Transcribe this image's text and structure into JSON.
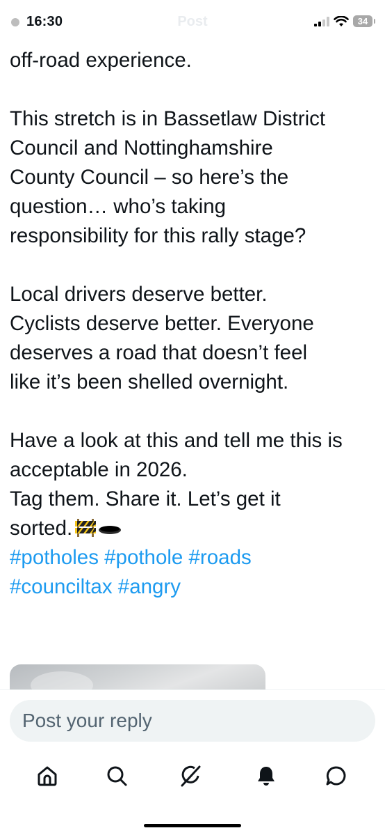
{
  "status_bar": {
    "time": "16:30",
    "header_title": "Post",
    "battery": "34"
  },
  "tweet": {
    "lines_first": [
      "off-road experience."
    ],
    "para2": [
      "This stretch is in Bassetlaw District",
      "Council and Nottinghamshire",
      "County Council – so here’s the",
      "question… who’s taking",
      "responsibility for this rally stage?"
    ],
    "para3": [
      "Local drivers deserve better.",
      "Cyclists deserve better. Everyone",
      "deserves a road that doesn’t feel",
      "like it’s been shelled overnight."
    ],
    "para4": [
      "Have a look at this and tell me this is",
      "acceptable in 2026.",
      "Tag them. Share it. Let’s get it"
    ],
    "last_line": "sorted.",
    "hashtags_line1": "#potholes #pothole #roads",
    "hashtags_line2": "#counciltax #angry",
    "emoji_names": [
      "construction-barrier-icon",
      "hole-icon"
    ]
  },
  "reply": {
    "placeholder": "Post your reply"
  },
  "nav": {
    "items": [
      "home-icon",
      "search-icon",
      "grok-icon",
      "notifications-icon",
      "messages-icon"
    ]
  },
  "colors": {
    "link": "#1d9bf0",
    "text": "#0f1419",
    "input_bg": "#eff3f4",
    "placeholder": "#536471"
  }
}
